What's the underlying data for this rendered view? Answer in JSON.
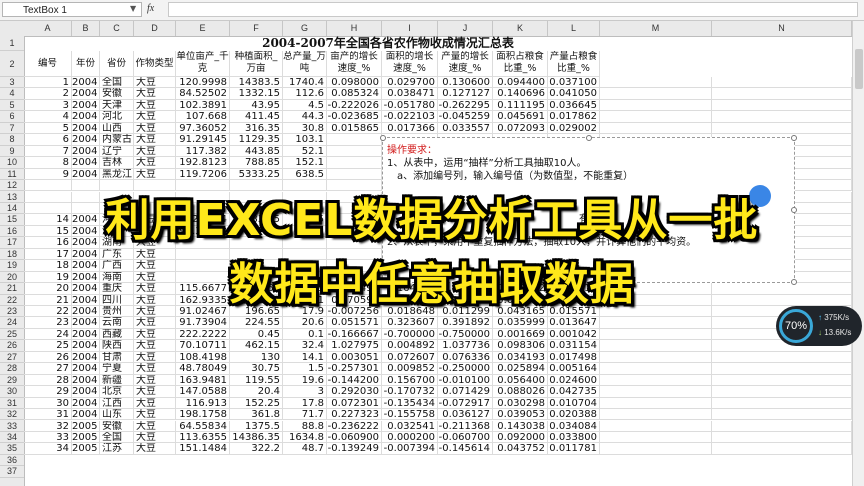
{
  "formula_bar": {
    "name_box": "TextBox 1",
    "fx_label": "fx",
    "formula": ""
  },
  "columns": [
    "A",
    "B",
    "C",
    "D",
    "E",
    "F",
    "G",
    "H",
    "I",
    "J",
    "K",
    "L",
    "M",
    "N"
  ],
  "row_numbers": [
    1,
    2,
    3,
    4,
    5,
    6,
    7,
    8,
    9,
    10,
    11,
    12,
    13,
    14,
    15,
    16,
    17,
    18,
    19,
    20,
    21,
    22,
    23,
    24,
    25,
    26,
    27,
    28,
    29,
    30,
    31,
    32,
    33,
    34,
    35,
    36,
    37
  ],
  "sheet_title": "2004-2007年全国各省农作物收成情况汇总表",
  "headers": [
    "编号",
    "年份",
    "省份",
    "作物类型",
    "单位亩产_千克",
    "种植面积_万亩",
    "总产量_万吨",
    "亩产的增长速度_%",
    "面积的增长速度_%",
    "产量的增长速度_%",
    "面积占粮食比重_%",
    "产量占粮食比重_%"
  ],
  "rows": [
    [
      "1",
      "2004",
      "全国",
      "大豆",
      "120.9998",
      "14383.5",
      "1740.4",
      "0.098000",
      "0.029700",
      "0.130600",
      "0.094400",
      "0.037100"
    ],
    [
      "2",
      "2004",
      "安徽",
      "大豆",
      "84.52502",
      "1332.15",
      "112.6",
      "0.085324",
      "0.038471",
      "0.127127",
      "0.140696",
      "0.041050"
    ],
    [
      "3",
      "2004",
      "天津",
      "大豆",
      "102.3891",
      "43.95",
      "4.5",
      "-0.222026",
      "-0.051780",
      "-0.262295",
      "0.111195",
      "0.036645"
    ],
    [
      "4",
      "2004",
      "河北",
      "大豆",
      "107.668",
      "411.45",
      "44.3",
      "-0.023685",
      "-0.022103",
      "-0.045259",
      "0.045691",
      "0.017862"
    ],
    [
      "5",
      "2004",
      "山西",
      "大豆",
      "97.36052",
      "316.35",
      "30.8",
      "0.015865",
      "0.017366",
      "0.033557",
      "0.072093",
      "0.029002"
    ],
    [
      "6",
      "2004",
      "内蒙古",
      "大豆",
      "91.29145",
      "1129.35",
      "103.1",
      "",
      "",
      "",
      "",
      ""
    ],
    [
      "7",
      "2004",
      "辽宁",
      "大豆",
      "117.382",
      "443.85",
      "52.1",
      "",
      "",
      "",
      "",
      ""
    ],
    [
      "8",
      "2004",
      "吉林",
      "大豆",
      "192.8123",
      "788.85",
      "152.1",
      "",
      "",
      "",
      "",
      ""
    ],
    [
      "9",
      "2004",
      "黑龙江",
      "大豆",
      "119.7206",
      "5333.25",
      "638.5",
      "",
      "",
      "",
      "",
      ""
    ],
    [
      "",
      "",
      "",
      "",
      "",
      "",
      "",
      "",
      "",
      "",
      "",
      ""
    ],
    [
      "",
      "",
      "",
      "",
      "",
      "",
      "",
      "",
      "",
      "",
      "",
      ""
    ],
    [
      "",
      "",
      "",
      "",
      "",
      "",
      "",
      "",
      "",
      "",
      "",
      ""
    ],
    [
      "14",
      "2004",
      "河南",
      "大豆",
      "132.0574",
      "783.75",
      "103.5",
      "",
      "",
      "",
      "",
      ""
    ],
    [
      "15",
      "2004",
      "湖北",
      "大豆",
      "96.39998",
      "275.7",
      "",
      "",
      "",
      "",
      "",
      ""
    ],
    [
      "16",
      "2004",
      "湖南",
      "大豆",
      "",
      "",
      "",
      "",
      "",
      "",
      "",
      ""
    ],
    [
      "17",
      "2004",
      "广东",
      "大豆",
      "",
      "",
      "",
      "",
      "",
      "",
      "",
      ""
    ],
    [
      "18",
      "2004",
      "广西",
      "大豆",
      "",
      "",
      "",
      "",
      "",
      "",
      "",
      ""
    ],
    [
      "19",
      "2004",
      "海南",
      "大豆",
      "",
      "",
      "",
      "",
      "",
      "",
      "",
      ""
    ],
    [
      "20",
      "2004",
      "重庆",
      "大豆",
      "115.6677",
      "142.65",
      "16.5",
      "0.417496",
      "0.164015",
      "0.650000",
      "0.037792",
      "0.014417"
    ],
    [
      "21",
      "2004",
      "四川",
      "大豆",
      "162.9335",
      "301.35",
      "49.1",
      "0.070593",
      "-0.002978",
      "0.067391",
      "0.031020",
      "0.015604"
    ],
    [
      "22",
      "2004",
      "贵州",
      "大豆",
      "91.02467",
      "196.65",
      "17.9",
      "-0.007256",
      "0.018648",
      "0.011299",
      "0.043165",
      "0.015571"
    ],
    [
      "23",
      "2004",
      "云南",
      "大豆",
      "91.73904",
      "224.55",
      "20.6",
      "0.051571",
      "0.323607",
      "0.391892",
      "0.035999",
      "0.013647"
    ],
    [
      "24",
      "2004",
      "西藏",
      "大豆",
      "222.2222",
      "0.45",
      "0.1",
      "-0.166667",
      "-0.700000",
      "-0.750000",
      "0.001669",
      "0.001042"
    ],
    [
      "25",
      "2004",
      "陕西",
      "大豆",
      "70.10711",
      "462.15",
      "32.4",
      "1.027975",
      "0.004892",
      "1.037736",
      "0.098306",
      "0.031154"
    ],
    [
      "26",
      "2004",
      "甘肃",
      "大豆",
      "108.4198",
      "130",
      "14.1",
      "0.003051",
      "0.072607",
      "0.076336",
      "0.034193",
      "0.017498"
    ],
    [
      "27",
      "2004",
      "宁夏",
      "大豆",
      "48.78049",
      "30.75",
      "1.5",
      "-0.257301",
      "0.009852",
      "-0.250000",
      "0.025894",
      "0.005164"
    ],
    [
      "28",
      "2004",
      "新疆",
      "大豆",
      "163.9481",
      "119.55",
      "19.6",
      "-0.144200",
      "0.156700",
      "-0.010100",
      "0.056400",
      "0.024600"
    ],
    [
      "29",
      "2004",
      "北京",
      "大豆",
      "147.0588",
      "20.4",
      "3",
      "0.292030",
      "-0.170732",
      "0.071429",
      "0.088026",
      "0.042735"
    ],
    [
      "30",
      "2004",
      "江西",
      "大豆",
      "116.913",
      "152.25",
      "17.8",
      "0.072301",
      "-0.135434",
      "-0.072917",
      "0.030298",
      "0.010704"
    ],
    [
      "31",
      "2004",
      "山东",
      "大豆",
      "198.1758",
      "361.8",
      "71.7",
      "0.227323",
      "-0.155758",
      "0.036127",
      "0.039053",
      "0.020388"
    ],
    [
      "32",
      "2005",
      "安徽",
      "大豆",
      "64.55834",
      "1375.5",
      "88.8",
      "-0.236222",
      "0.032541",
      "-0.211368",
      "0.143038",
      "0.034084"
    ],
    [
      "33",
      "2005",
      "全国",
      "大豆",
      "113.6355",
      "14386.35",
      "1634.8",
      "-0.060900",
      "0.000200",
      "-0.060700",
      "0.092000",
      "0.033800"
    ],
    [
      "34",
      "2005",
      "江苏",
      "大豆",
      "151.1484",
      "322.2",
      "48.7",
      "-0.139249",
      "-0.007394",
      "-0.145614",
      "0.043752",
      "0.011781"
    ]
  ],
  "note": {
    "title": "操作要求：",
    "lines": [
      "1、从表中，运用“抽样”分析工具抽取10人。",
      "a、添加编号列，输入编号值（为数值型，不能重复）",
      "有数",
      "2、从表中，采用不重复抽样方法，抽取10人，并计算他们的平均资。"
    ]
  },
  "overlay": {
    "line1": "利用EXCEL数据分析工具从一批",
    "line2": "数据中任意抽取数据",
    "color": "#ffe81a"
  },
  "net_widget": {
    "percent": "70%",
    "upload": "375K/s",
    "download": "13.6K/s"
  }
}
